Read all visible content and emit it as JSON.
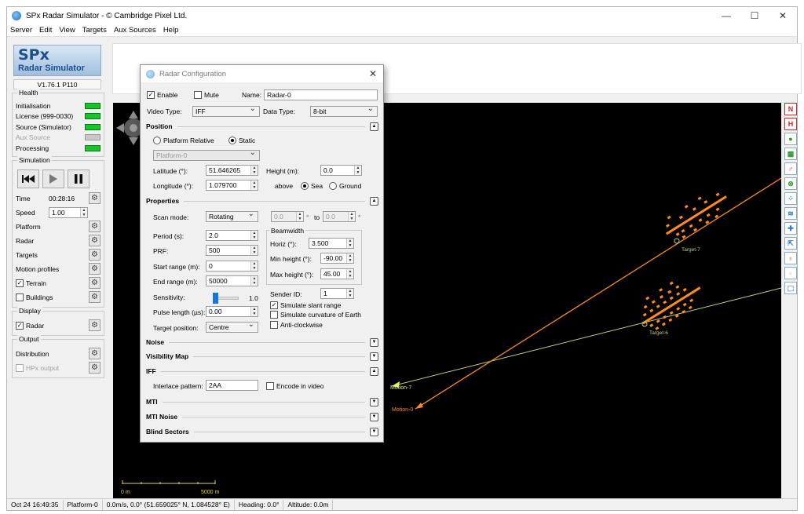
{
  "window": {
    "title": "SPx Radar Simulator - © Cambridge Pixel Ltd."
  },
  "menu": [
    "Server",
    "Edit",
    "View",
    "Targets",
    "Aux Sources",
    "Help"
  ],
  "logo": {
    "line1": "SPx",
    "line2": "Radar Simulator"
  },
  "version": "V1.76.1 P110",
  "health": {
    "title": "Health",
    "items": [
      {
        "label": "Initialisation",
        "status": "ok"
      },
      {
        "label": "License (999-0030)",
        "status": "ok"
      },
      {
        "label": "Source (Simulator)",
        "status": "ok"
      },
      {
        "label": "Aux Source",
        "status": "disabled"
      },
      {
        "label": "Processing",
        "status": "ok"
      }
    ]
  },
  "simulation": {
    "title": "Simulation",
    "time_label": "Time",
    "time_value": "00:28:16",
    "speed_label": "Speed",
    "speed_value": "1.00",
    "items": [
      "Platform",
      "Radar",
      "Targets",
      "Motion profiles"
    ],
    "terrain_label": "Terrain",
    "buildings_label": "Buildings"
  },
  "display": {
    "title": "Display",
    "radar_label": "Radar"
  },
  "output": {
    "title": "Output",
    "distribution_label": "Distribution",
    "hpx_label": "HPx output"
  },
  "status": {
    "time": "Oct 24 16:49:35",
    "platform": "Platform-0",
    "motion": "0.0m/s, 0.0° (51.659025° N, 1.084528° E)",
    "heading": "Heading: 0.0°",
    "altitude": "Altitude: 0.0m"
  },
  "radarview": {
    "scale_start": "0 m",
    "scale_end": "5000 m",
    "motion7_label": "Motion-7",
    "motion0_label": "Motion-0",
    "target7_label": "Target-7",
    "target6_label": "Target-6",
    "colors": {
      "orange": "#ff8c1a",
      "green": "#b8d67a"
    }
  },
  "dialog": {
    "title": "Radar Configuration",
    "enable_label": "Enable",
    "mute_label": "Mute",
    "name_label": "Name:",
    "name_value": "Radar-0",
    "video_type_label": "Video Type:",
    "video_type_value": "IFF",
    "data_type_label": "Data Type:",
    "data_type_value": "8-bit",
    "position": {
      "title": "Position",
      "platform_relative": "Platform Relative",
      "static": "Static",
      "platform_value": "Platform-0",
      "latitude_label": "Latitude (°):",
      "latitude_value": "51.646265",
      "longitude_label": "Longitude (°):",
      "longitude_value": "1.079700",
      "height_label": "Height (m):",
      "height_value": "0.0",
      "above_label": "above",
      "sea_label": "Sea",
      "ground_label": "Ground"
    },
    "properties": {
      "title": "Properties",
      "scan_mode_label": "Scan mode:",
      "scan_mode_value": "Rotating",
      "sector_from": "0.0",
      "sector_to": "0.0",
      "to_label": "to",
      "deg_label": "°",
      "period_label": "Period (s):",
      "period_value": "2.0",
      "prf_label": "PRF:",
      "prf_value": "500",
      "start_range_label": "Start range (m):",
      "start_range_value": "0",
      "end_range_label": "End range (m):",
      "end_range_value": "50000",
      "sensitivity_label": "Sensitivity:",
      "sensitivity_value": "1.0",
      "pulse_label": "Pulse length (µs):",
      "pulse_value": "0.00",
      "target_pos_label": "Target position:",
      "target_pos_value": "Centre",
      "beamwidth_title": "Beamwidth",
      "horiz_label": "Horiz (°):",
      "horiz_value": "3.500",
      "min_height_label": "Min height (°):",
      "min_height_value": "-90.00",
      "max_height_label": "Max height (°):",
      "max_height_value": "45.00",
      "sender_label": "Sender ID:",
      "sender_value": "1",
      "slant_label": "Simulate slant range",
      "curvature_label": "Simulate curvature of Earth",
      "anticlockwise_label": "Anti-clockwise"
    },
    "sections": {
      "noise": "Noise",
      "visibility": "Visibility Map",
      "iff": "IFF",
      "mti": "MTI",
      "mti_noise": "MTI Noise",
      "blind": "Blind Sectors"
    },
    "iff": {
      "interlace_label": "Interlace pattern:",
      "interlace_value": "2AA",
      "encode_label": "Encode in video"
    }
  }
}
